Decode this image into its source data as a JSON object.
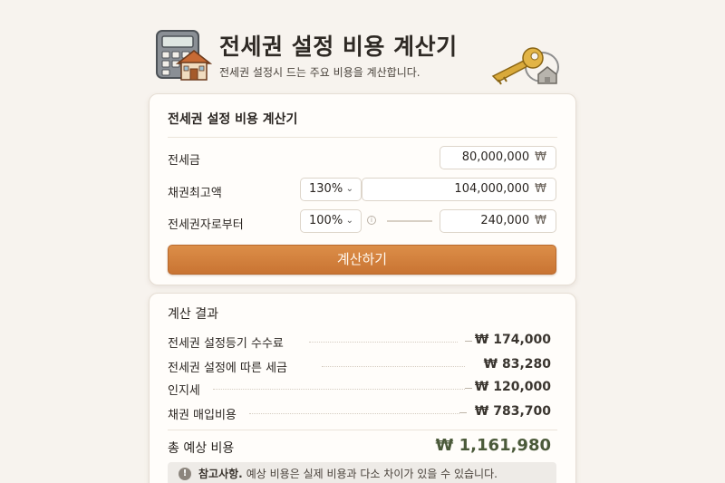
{
  "header": {
    "title": "전세권 설정 비용 계산기",
    "subtitle": "전세권 설정시 드는 주요 비용을 계산합니다."
  },
  "form": {
    "title": "전세권 설정 비용 계산기",
    "rows": [
      {
        "label": "전세금",
        "value": "80,000,000",
        "unit": "₩"
      },
      {
        "label": "채권최고액",
        "select": "130%",
        "value": "104,000,000",
        "unit": "₩"
      },
      {
        "label": "전세권자로부터",
        "select": "100%",
        "value": "240,000",
        "unit": "₩"
      }
    ],
    "button": "계산하기"
  },
  "result": {
    "title": "계산 결과",
    "rows": [
      {
        "label": "전세권 설정등기 수수료",
        "value": "₩ 174,000"
      },
      {
        "label": "전세권 설정에 따른 세금",
        "value": "₩ 83,280"
      },
      {
        "label": "인지세",
        "value": "₩ 120,000"
      },
      {
        "label": "채권 매입비용",
        "value": "₩ 783,700"
      }
    ],
    "total_label": "총 예상 비용",
    "total_value": "₩ 1,161,980",
    "note_strong": "참고사항.",
    "note_text": "예상 비용은 실제 비용과 다소 차이가 있을 수 있습니다.",
    "note_icon": "!"
  },
  "colors": {
    "accent": "#d2813d",
    "total": "#4b5a3a",
    "background": "#f7f3ee"
  }
}
